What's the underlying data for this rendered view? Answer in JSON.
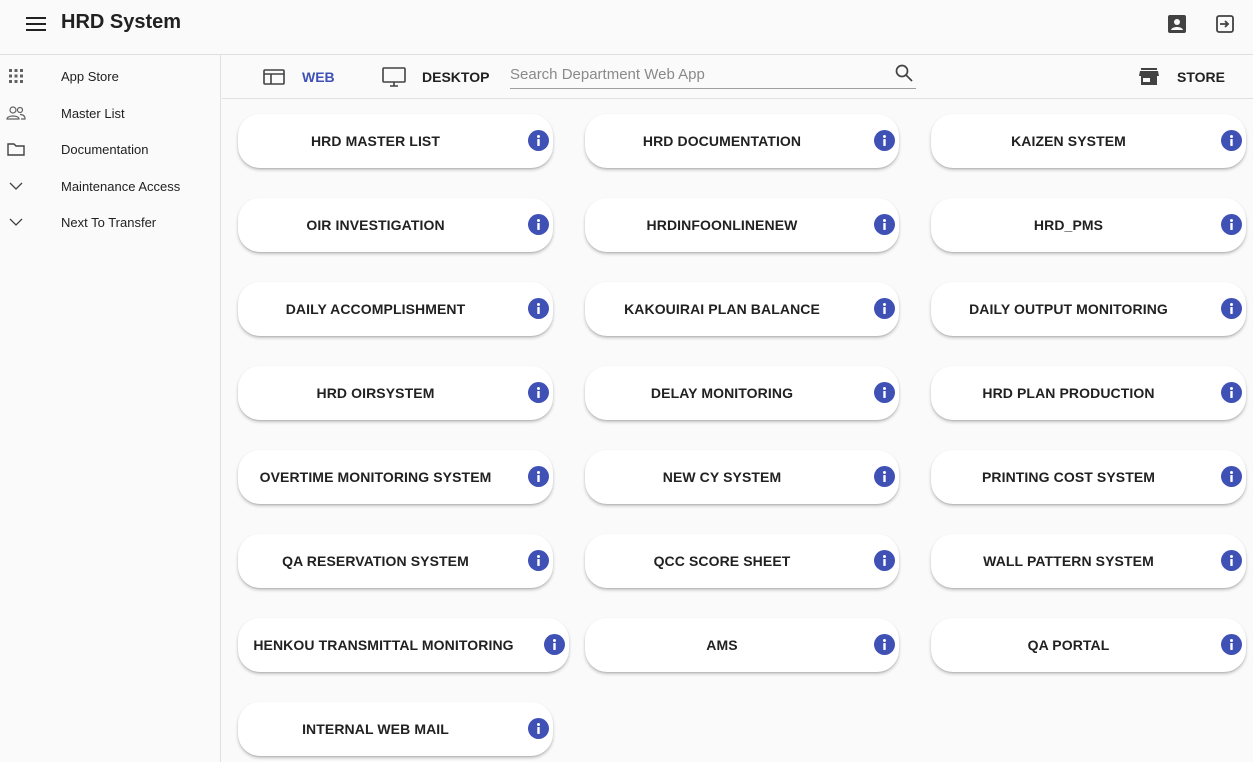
{
  "header": {
    "title": "HRD System",
    "menu_icon": "menu-icon",
    "account_icon": "account-box-icon",
    "logout_icon": "logout-icon"
  },
  "sidebar": {
    "items": [
      {
        "label": "App Store",
        "icon": "apps-grid-icon"
      },
      {
        "label": "Master List",
        "icon": "people-icon"
      },
      {
        "label": "Documentation",
        "icon": "folder-icon"
      },
      {
        "label": "Maintenance Access",
        "icon": "chevron-down-icon"
      },
      {
        "label": "Next To Transfer",
        "icon": "chevron-down-icon"
      }
    ]
  },
  "toolbar": {
    "web_label": "WEB",
    "desktop_label": "DESKTOP",
    "store_label": "STORE",
    "search_placeholder": "Search Department Web App",
    "search_value": "",
    "accent_color": "#3f51b5"
  },
  "apps": [
    {
      "title": "HRD MASTER LIST"
    },
    {
      "title": "HRD DOCUMENTATION"
    },
    {
      "title": "KAIZEN SYSTEM"
    },
    {
      "title": "OIR INVESTIGATION"
    },
    {
      "title": "HRDINFOONLINENEW"
    },
    {
      "title": "HRD_PMS"
    },
    {
      "title": "DAILY ACCOMPLISHMENT"
    },
    {
      "title": "KAKOUIRAI PLAN BALANCE"
    },
    {
      "title": "DAILY OUTPUT MONITORING"
    },
    {
      "title": "HRD OIRSYSTEM"
    },
    {
      "title": "DELAY MONITORING"
    },
    {
      "title": "HRD PLAN PRODUCTION"
    },
    {
      "title": "OVERTIME MONITORING SYSTEM"
    },
    {
      "title": "NEW CY SYSTEM"
    },
    {
      "title": "PRINTING COST SYSTEM"
    },
    {
      "title": "QA RESERVATION SYSTEM"
    },
    {
      "title": "QCC SCORE SHEET"
    },
    {
      "title": "WALL PATTERN SYSTEM"
    },
    {
      "title": "HENKOU TRANSMITTAL MONITORING"
    },
    {
      "title": "AMS"
    },
    {
      "title": "QA PORTAL"
    },
    {
      "title": "INTERNAL WEB MAIL"
    }
  ]
}
